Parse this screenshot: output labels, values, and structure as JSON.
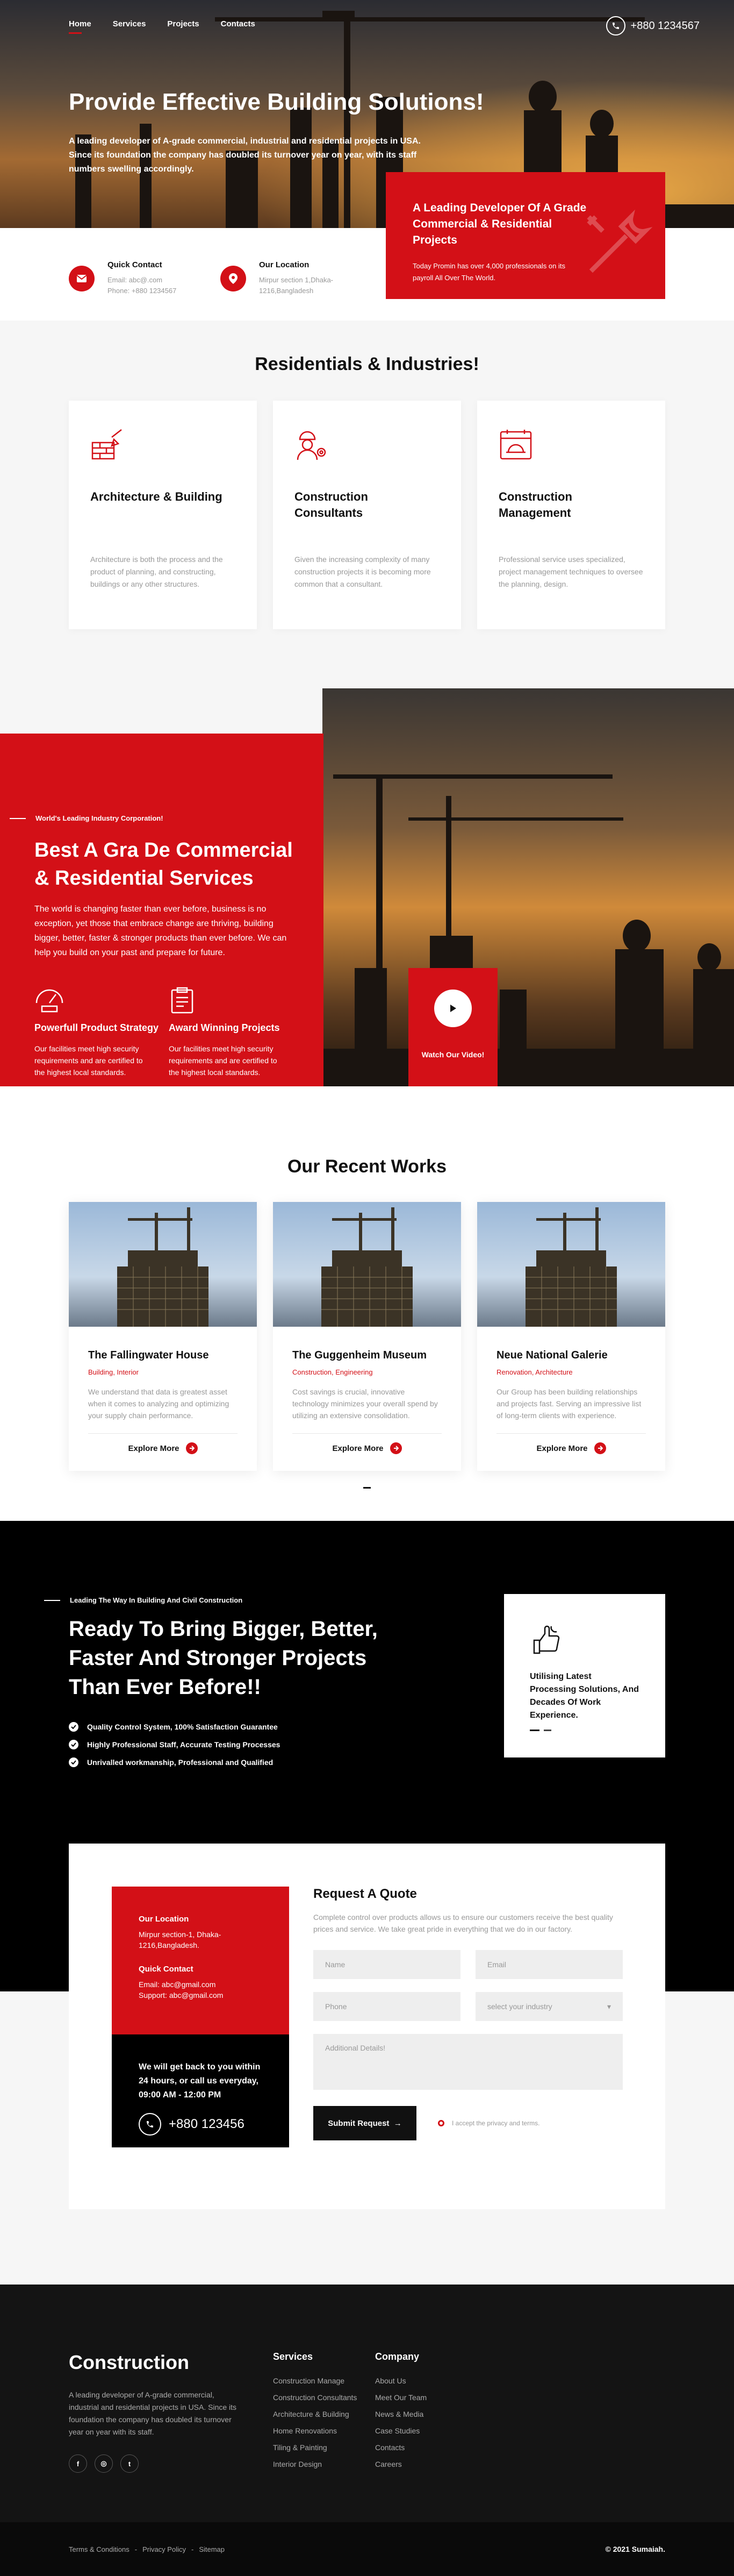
{
  "nav": {
    "items": [
      "Home",
      "Services",
      "Projects",
      "Contacts"
    ],
    "active": "Home"
  },
  "header": {
    "phone": "+880 1234567"
  },
  "hero": {
    "title": "Provide Effective Building Solutions!",
    "text": "A leading developer of A-grade commercial, industrial and residential projects in USA. Since its foundation the company has doubled its turnover year on year, with its staff numbers swelling accordingly."
  },
  "promo": {
    "title": "A Leading Developer Of A Grade Commercial & Residential Projects",
    "text": "Today Promin has over 4,000 professionals on its payroll All Over The World."
  },
  "contact_strip": {
    "quick": {
      "title": "Quick Contact",
      "email": "Email: abc@.com",
      "phone": "Phone: +880 1234567"
    },
    "location": {
      "title": "Our Location",
      "address": "Mirpur section 1,Dhaka-1216,Bangladesh"
    }
  },
  "services": {
    "title": "Residentials & Industries!",
    "cards": [
      {
        "title": "Architecture & Building",
        "text": "Architecture is both the process and the product of planning, and constructing, buildings or any other structures."
      },
      {
        "title": "Construction Consultants",
        "text": "Given the increasing complexity of many construction projects it is becoming more common that a consultant."
      },
      {
        "title": "Construction Management",
        "text": "Professional service uses specialized, project management techniques to oversee the planning, design."
      }
    ]
  },
  "about": {
    "tag": "World's Leading Industry Corporation!",
    "title": "Best A Gra De Commercial & Residential Services",
    "text": "The world is changing faster than ever before, business is no exception, yet those that embrace change are thriving, building bigger, better, faster & stronger products than ever before. We can help you build on your past and prepare for future.",
    "features": [
      {
        "title": "Powerfull Product Strategy",
        "text": "Our facilities meet high security requirements and are certified to the highest local standards."
      },
      {
        "title": "Award Winning Projects",
        "text": "Our facilities meet high security requirements and are certified to the highest local standards."
      }
    ],
    "video_label": "Watch Our Video!"
  },
  "works": {
    "title": "Our Recent Works",
    "items": [
      {
        "title": "The Fallingwater House",
        "category": "Building, Interior",
        "text": "We understand that data is greatest asset when it comes to analyzing and optimizing your supply chain performance.",
        "more": "Explore More"
      },
      {
        "title": "The Guggenheim Museum",
        "category": "Construction, Engineering",
        "text": "Cost savings is crucial, innovative technology minimizes your overall spend by utilizing an extensive consolidation.",
        "more": "Explore More"
      },
      {
        "title": "Neue National Galerie",
        "category": "Renovation, Architecture",
        "text": "Our Group has been building relationships and projects fast. Serving an impressive list of long-term clients with experience.",
        "more": "Explore More"
      }
    ]
  },
  "cta": {
    "tag": "Leading The Way In Building And Civil Construction",
    "title": "Ready To Bring Bigger, Better, Faster And Stronger Projects Than Ever Before!!",
    "checks": [
      "Quality Control System, 100% Satisfaction Guarantee",
      "Highly Professional Staff, Accurate Testing Processes",
      "Unrivalled workmanship, Professional and Qualified"
    ],
    "feature": "Utilising Latest Processing Solutions, And Decades Of Work Experience."
  },
  "quote": {
    "location_title": "Our Location",
    "location_text": "Mirpur section-1, Dhaka-1216,Bangladesh.",
    "contact_title": "Quick Contact",
    "email": "Email: abc@gmail.com",
    "support": "Support: abc@gmail.com",
    "callback": "We will get back to you within 24 hours, or call us everyday, 09:00 AM - 12:00 PM",
    "phone": "+880 123456",
    "title": "Request A Quote",
    "intro": "Complete control over products allows us to ensure our customers receive the best quality prices and service. We take great pride in everything that we do in our factory.",
    "fields": {
      "name": "Name",
      "email": "Email",
      "phone": "Phone",
      "industry": "select your industry",
      "details": "Additional Details!"
    },
    "submit": "Submit Request",
    "agree": "I accept the privacy and terms."
  },
  "footer": {
    "brand": "Construction",
    "text": "A leading developer of A-grade commercial, industrial and residential projects in USA. Since its foundation the company has doubled its turnover year on year with its staff.",
    "social": [
      "f",
      "◎",
      "t"
    ],
    "services_title": "Services",
    "services": [
      "Construction Manage",
      "Construction Consultants",
      "Architecture & Building",
      "Home Renovations",
      "Tiling & Painting",
      "Interior Design"
    ],
    "company_title": "Company",
    "company": [
      "About Us",
      "Meet Our Team",
      "News & Media",
      "Case Studies",
      "Contacts",
      "Careers"
    ],
    "bottom_links": [
      "Terms & Conditions",
      "Privacy Policy",
      "Sitemap"
    ],
    "copyright": "© 2021 Sumaiah."
  },
  "colors": {
    "accent": "#d31017",
    "dark": "#000000",
    "footer": "#141414"
  }
}
